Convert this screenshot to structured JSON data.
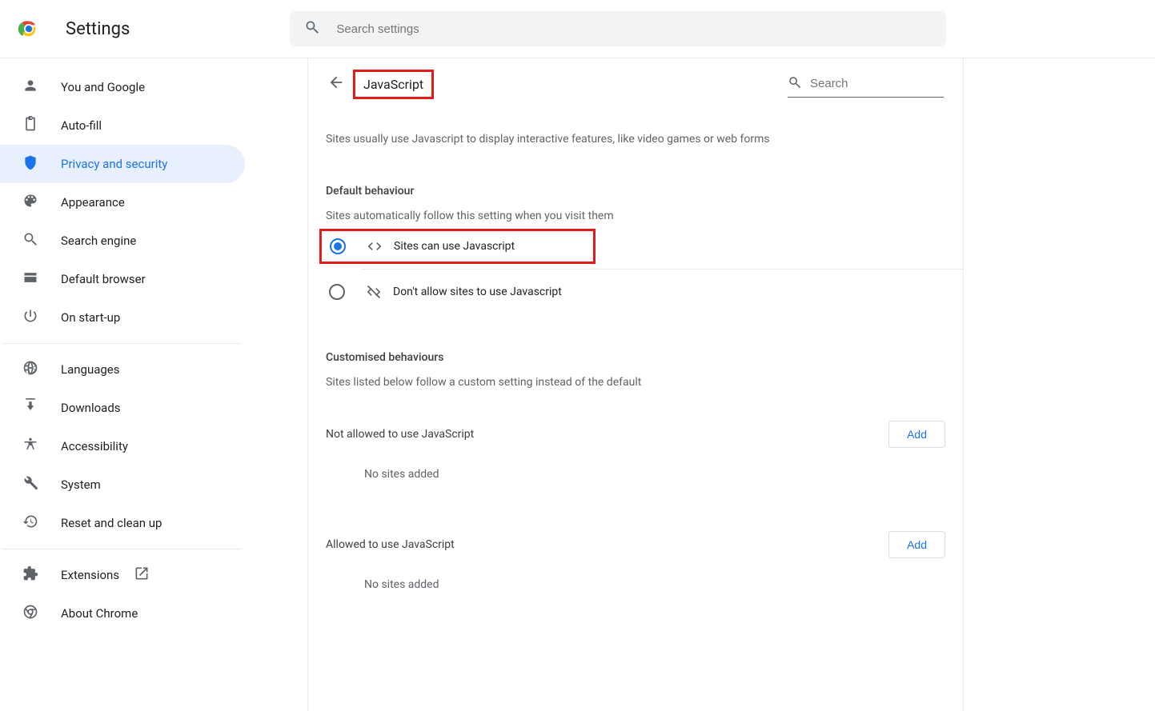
{
  "header": {
    "app_title": "Settings",
    "search_placeholder": "Search settings"
  },
  "sidebar": {
    "items": [
      {
        "id": "you-google",
        "label": "You and Google",
        "icon": "person"
      },
      {
        "id": "autofill",
        "label": "Auto-fill",
        "icon": "clipboard"
      },
      {
        "id": "privacy",
        "label": "Privacy and security",
        "icon": "shield",
        "active": true
      },
      {
        "id": "appearance",
        "label": "Appearance",
        "icon": "palette"
      },
      {
        "id": "search-engine",
        "label": "Search engine",
        "icon": "search"
      },
      {
        "id": "default-browser",
        "label": "Default browser",
        "icon": "browser"
      },
      {
        "id": "startup",
        "label": "On start-up",
        "icon": "power"
      }
    ],
    "items2": [
      {
        "id": "languages",
        "label": "Languages",
        "icon": "globe"
      },
      {
        "id": "downloads",
        "label": "Downloads",
        "icon": "download"
      },
      {
        "id": "accessibility",
        "label": "Accessibility",
        "icon": "accessibility"
      },
      {
        "id": "system",
        "label": "System",
        "icon": "wrench"
      },
      {
        "id": "reset",
        "label": "Reset and clean up",
        "icon": "history"
      }
    ],
    "items3": [
      {
        "id": "extensions",
        "label": "Extensions",
        "icon": "puzzle",
        "external": true
      },
      {
        "id": "about",
        "label": "About Chrome",
        "icon": "chrome-outline"
      }
    ]
  },
  "main": {
    "title": "JavaScript",
    "search_placeholder": "Search",
    "intro": "Sites usually use Javascript to display interactive features, like video games or web forms",
    "default_section_title": "Default behaviour",
    "default_section_desc": "Sites automatically follow this setting when you visit them",
    "radio": {
      "allow_label": "Sites can use Javascript",
      "block_label": "Don't allow sites to use Javascript"
    },
    "custom_section_title": "Customised behaviours",
    "custom_section_desc": "Sites listed below follow a custom setting instead of the default",
    "not_allowed_label": "Not allowed to use JavaScript",
    "allowed_label": "Allowed to use JavaScript",
    "empty_text": "No sites added",
    "add_button": "Add"
  }
}
